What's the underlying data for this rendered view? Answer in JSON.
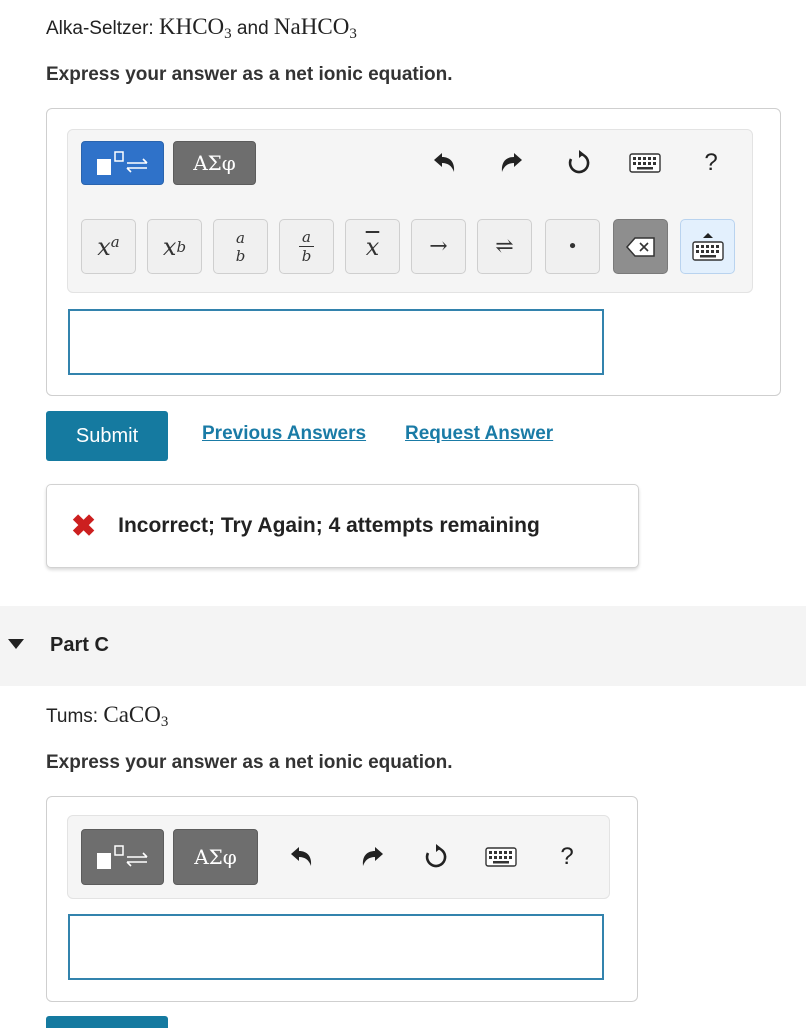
{
  "part_b": {
    "prompt_prefix": "Alka-Seltzer: ",
    "chem1": "KHCO",
    "chem1_sub": "3",
    "conj": " and ",
    "chem2": "NaHCO",
    "chem2_sub": "3",
    "instruction": "Express your answer as a net ionic equation.",
    "greek_label": "ΑΣφ",
    "help_label": "?",
    "keys": {
      "superscript_base": "x",
      "superscript_exp": "a",
      "subscript_base": "x",
      "subscript_sub": "b",
      "frac_num": "a",
      "frac_den": "b",
      "frac2_num": "a",
      "frac2_den": "b",
      "overline": "x",
      "arrow": "→",
      "equilibrium": "⇌",
      "dot": "•",
      "backspace": "⌫"
    },
    "answer_value": "",
    "submit_label": "Submit",
    "previous_answers_label": "Previous Answers",
    "request_answer_label": "Request Answer",
    "feedback_icon": "✖",
    "feedback_message": "Incorrect; Try Again; 4 attempts remaining"
  },
  "part_c": {
    "title": "Part C",
    "prompt_prefix": "Tums: ",
    "chem": "CaCO",
    "chem_sub": "3",
    "instruction": "Express your answer as a net ionic equation.",
    "greek_label": "ΑΣφ",
    "help_label": "?",
    "answer_value": ""
  },
  "colors": {
    "accent_blue": "#2f72c9",
    "submit_teal": "#157aa0",
    "link_blue": "#1a7ba6",
    "error_red": "#cc1f1f"
  }
}
